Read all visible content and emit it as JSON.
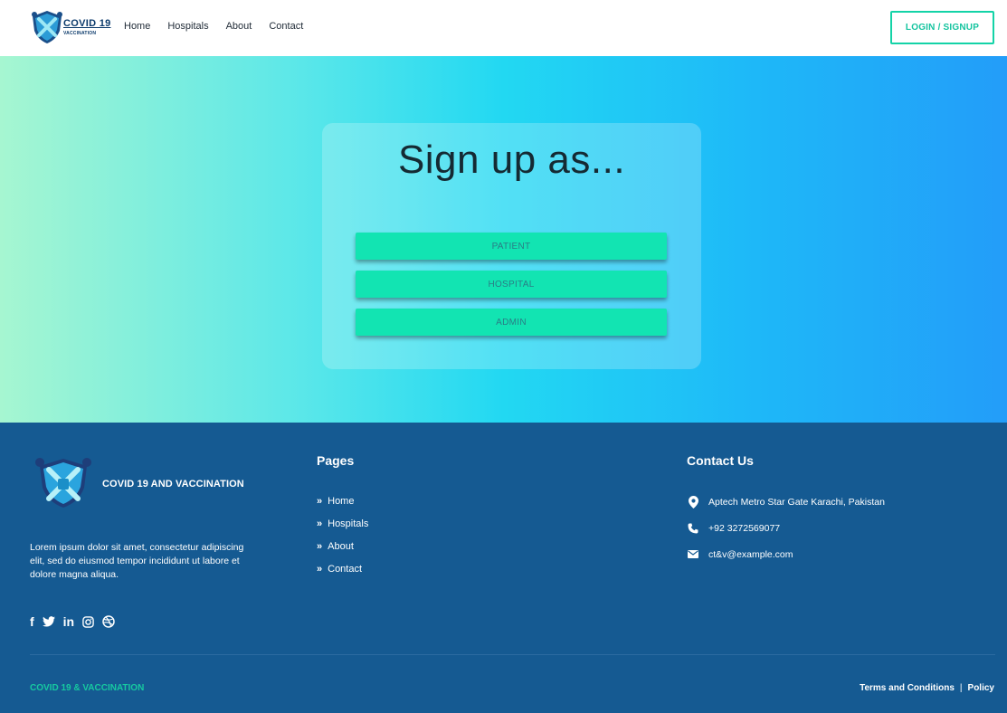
{
  "header": {
    "logo_text": "COVID 19",
    "logo_sub": "VACCINATION",
    "nav": [
      "Home",
      "Hospitals",
      "About",
      "Contact"
    ],
    "login_label": "LOGIN / SIGNUP"
  },
  "hero": {
    "title": "Sign up as...",
    "roles": [
      "PATIENT",
      "HOSPITAL",
      "ADMIN"
    ]
  },
  "footer": {
    "brand": "COVID 19 AND VACCINATION",
    "description": "Lorem ipsum dolor sit amet, consectetur adipiscing elit, sed do eiusmod tempor incididunt ut labore et dolore magna aliqua.",
    "social_icons": [
      "facebook-icon",
      "twitter-icon",
      "linkedin-icon",
      "instagram-icon",
      "dribbble-icon"
    ],
    "pages_title": "Pages",
    "pages": [
      "Home",
      "Hospitals",
      "About",
      "Contact"
    ],
    "contact_title": "Contact Us",
    "address": "Aptech Metro Star Gate Karachi, Pakistan",
    "phone": "+92 3272569077",
    "email": "ct&v@example.com",
    "copyright": "COVID 19 & VACCINATION",
    "terms": "Terms and Conditions",
    "separator": "|",
    "policy": "Policy"
  },
  "colors": {
    "accent": "#12e4b2",
    "footer_bg": "#155a92",
    "login_border": "#14d3a7"
  }
}
